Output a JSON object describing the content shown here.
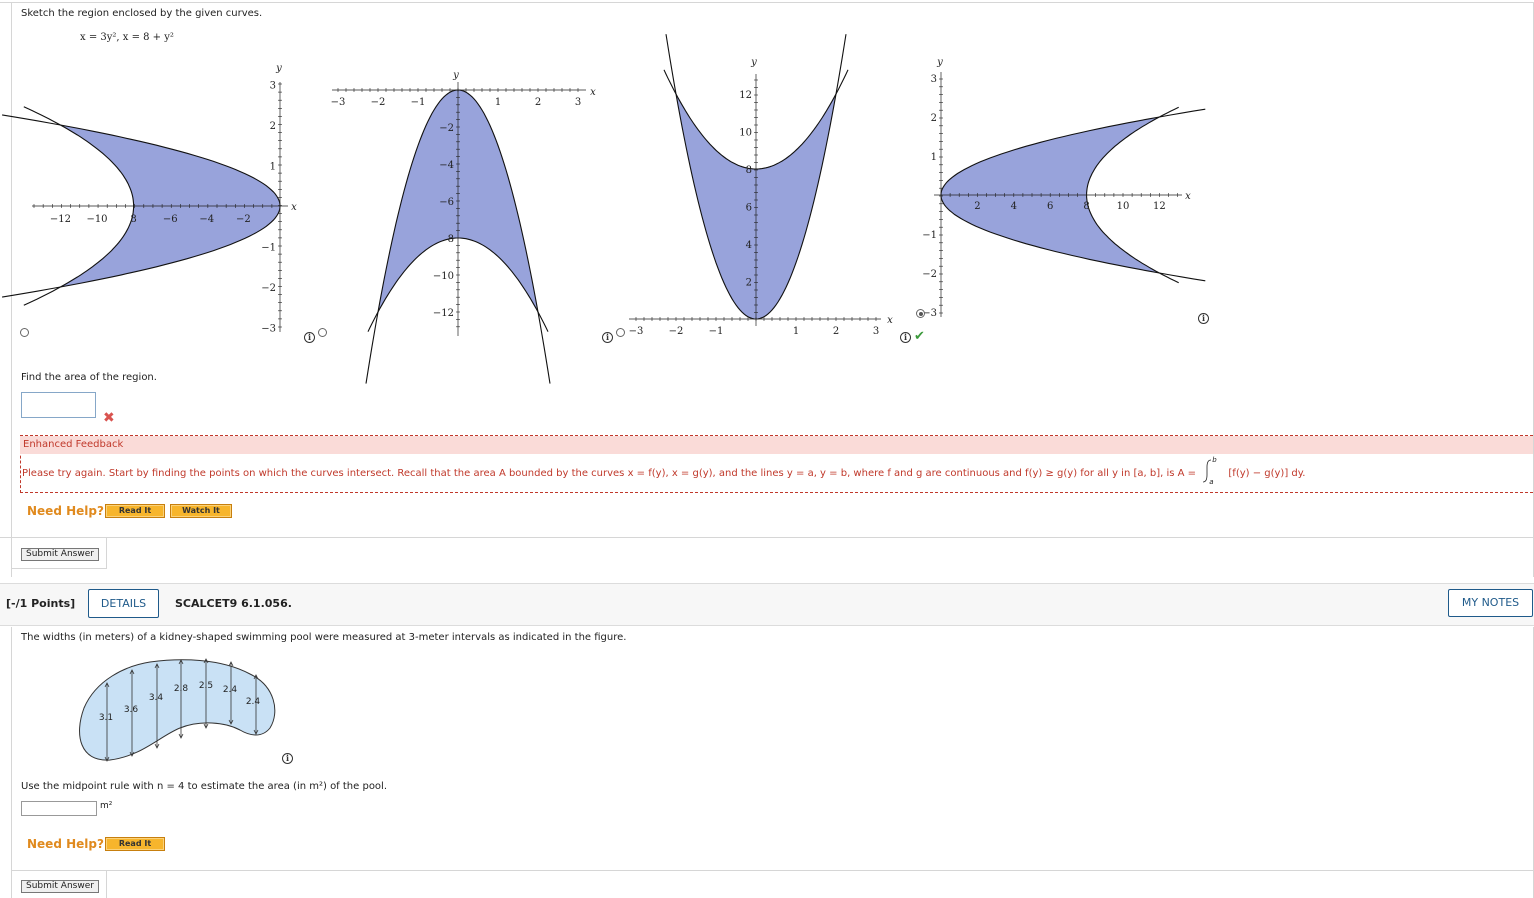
{
  "q1": {
    "prompt": "Sketch the region enclosed by the given curves.",
    "equation": "x = 3y², x = 8 + y²",
    "choices": [
      {
        "selected": false,
        "y_axis_label": "y",
        "x_axis_label": "x",
        "x_ticks": [
          "−12",
          "−10",
          "8",
          "−6",
          "−4",
          "−2"
        ],
        "y_ticks": [
          "3",
          "2",
          "1",
          "−1",
          "−2",
          "−3"
        ]
      },
      {
        "selected": false,
        "y_axis_label": "y",
        "x_axis_label": "x",
        "x_ticks": [
          "−3",
          "−2",
          "−1",
          "1",
          "2",
          "3"
        ],
        "y_ticks": [
          "−2",
          "−4",
          "−6",
          "8",
          "−10",
          "−12"
        ]
      },
      {
        "selected": false,
        "y_axis_label": "y",
        "x_axis_label": "x",
        "x_ticks": [
          "−3",
          "−2",
          "−1",
          "1",
          "2",
          "3"
        ],
        "y_ticks": [
          "12",
          "10",
          "8",
          "6",
          "4",
          "2"
        ]
      },
      {
        "selected": true,
        "y_axis_label": "y",
        "x_axis_label": "x",
        "x_ticks": [
          "2",
          "4",
          "6",
          "8",
          "10",
          "12"
        ],
        "y_ticks": [
          "3",
          "2",
          "1",
          "−1",
          "−2",
          "−3"
        ]
      }
    ],
    "region_fill": "#98a3db",
    "find_area_prompt": "Find the area of the region.",
    "area_input_value": "",
    "feedback": {
      "title": "Enhanced Feedback",
      "text": "Please try again. Start by finding the points on which the curves intersect. Recall that the area A bounded by the curves x = f(y), x = g(y), and the lines y = a, y = b, where f and g are continuous and f(y) ≥ g(y) for all y in [a, b], is A =",
      "integral_upper": "b",
      "integral_lower": "a",
      "integrand": "[f(y) − g(y)] dy."
    },
    "need_help": "Need Help?",
    "read_it": "Read It",
    "watch_it": "Watch It",
    "submit": "Submit Answer"
  },
  "q2": {
    "points": "[-/1 Points]",
    "details": "DETAILS",
    "code": "SCALCET9 6.1.056.",
    "my_notes": "MY NOTES",
    "prompt": "The widths (in meters) of a kidney-shaped swimming pool were measured at 3-meter intervals as indicated in the figure.",
    "widths": [
      "3.1",
      "3.6",
      "3.4",
      "2.8",
      "2.5",
      "2.4",
      "2.4"
    ],
    "midpoint_prompt": "Use the midpoint rule with n = 4 to estimate the area (in m²) of the pool.",
    "unit": "m²",
    "input_value": "",
    "need_help": "Need Help?",
    "read_it": "Read It",
    "submit": "Submit Answer"
  }
}
